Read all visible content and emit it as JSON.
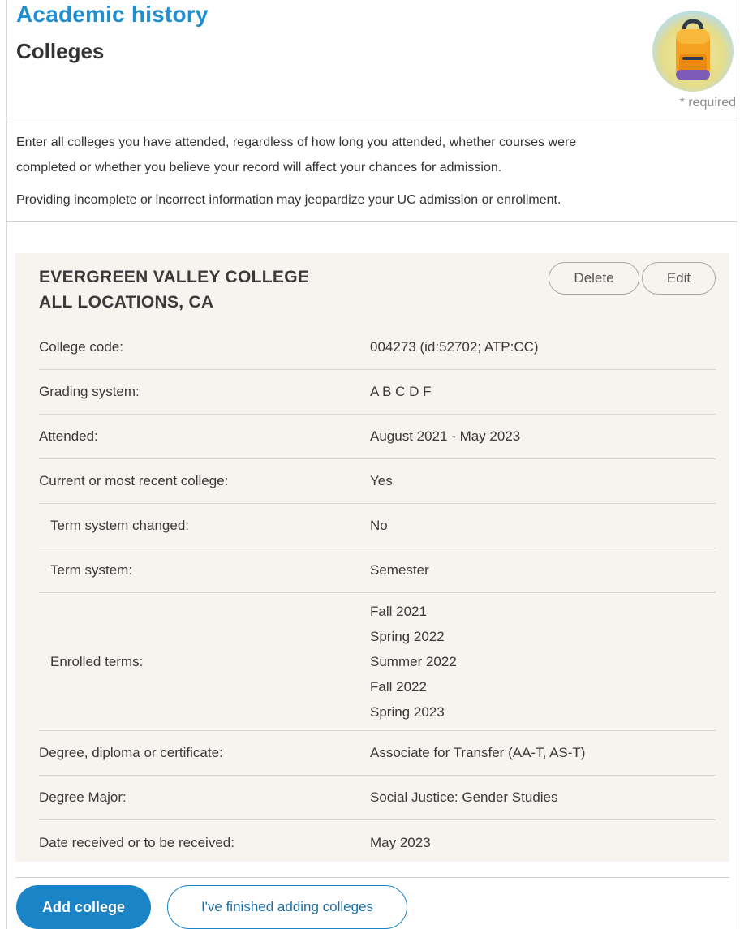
{
  "header": {
    "section_title": "Academic history",
    "page_title": "Colleges",
    "required_note": "* required"
  },
  "intro": {
    "paragraph_1": "Enter all colleges you have attended, regardless of how long you attended, whether courses were completed or whether you believe your record will affect your chances for admission.",
    "paragraph_2": "Providing incomplete or incorrect information may jeopardize your UC admission or enrollment."
  },
  "college": {
    "name": "EVERGREEN VALLEY COLLEGE",
    "location": "ALL LOCATIONS, CA",
    "delete_label": "Delete",
    "edit_label": "Edit",
    "rows": [
      {
        "label": "College code:",
        "value": "004273 (id:52702; ATP:CC)"
      },
      {
        "label": "Grading system:",
        "value": "A B C D F"
      },
      {
        "label": "Attended:",
        "value": "August 2021 - May 2023"
      },
      {
        "label": "Current or most recent college:",
        "value": "Yes"
      },
      {
        "label": "Term system changed:",
        "value": "No"
      },
      {
        "label": "Term system:",
        "value": "Semester"
      },
      {
        "label": "Enrolled terms:",
        "terms": [
          "Fall 2021",
          "Spring 2022",
          "Summer 2022",
          "Fall 2022",
          "Spring 2023"
        ]
      },
      {
        "label": "Degree, diploma or certificate:",
        "value": "Associate for Transfer (AA-T, AS-T)"
      },
      {
        "label": "Degree Major:",
        "value": "Social Justice: Gender Studies"
      },
      {
        "label": "Date received or to be received:",
        "value": "May 2023"
      }
    ]
  },
  "actions": {
    "add_label": "Add college",
    "finished_label": "I've finished adding colleges"
  },
  "colors": {
    "accent": "#1a84c7",
    "title_blue": "#1f8fcf",
    "card_bg": "#f7f3ef",
    "backpack_orange": "#f4a020",
    "icon_circle": "#e8df8a"
  },
  "icons": {
    "backpack": "backpack-icon"
  }
}
